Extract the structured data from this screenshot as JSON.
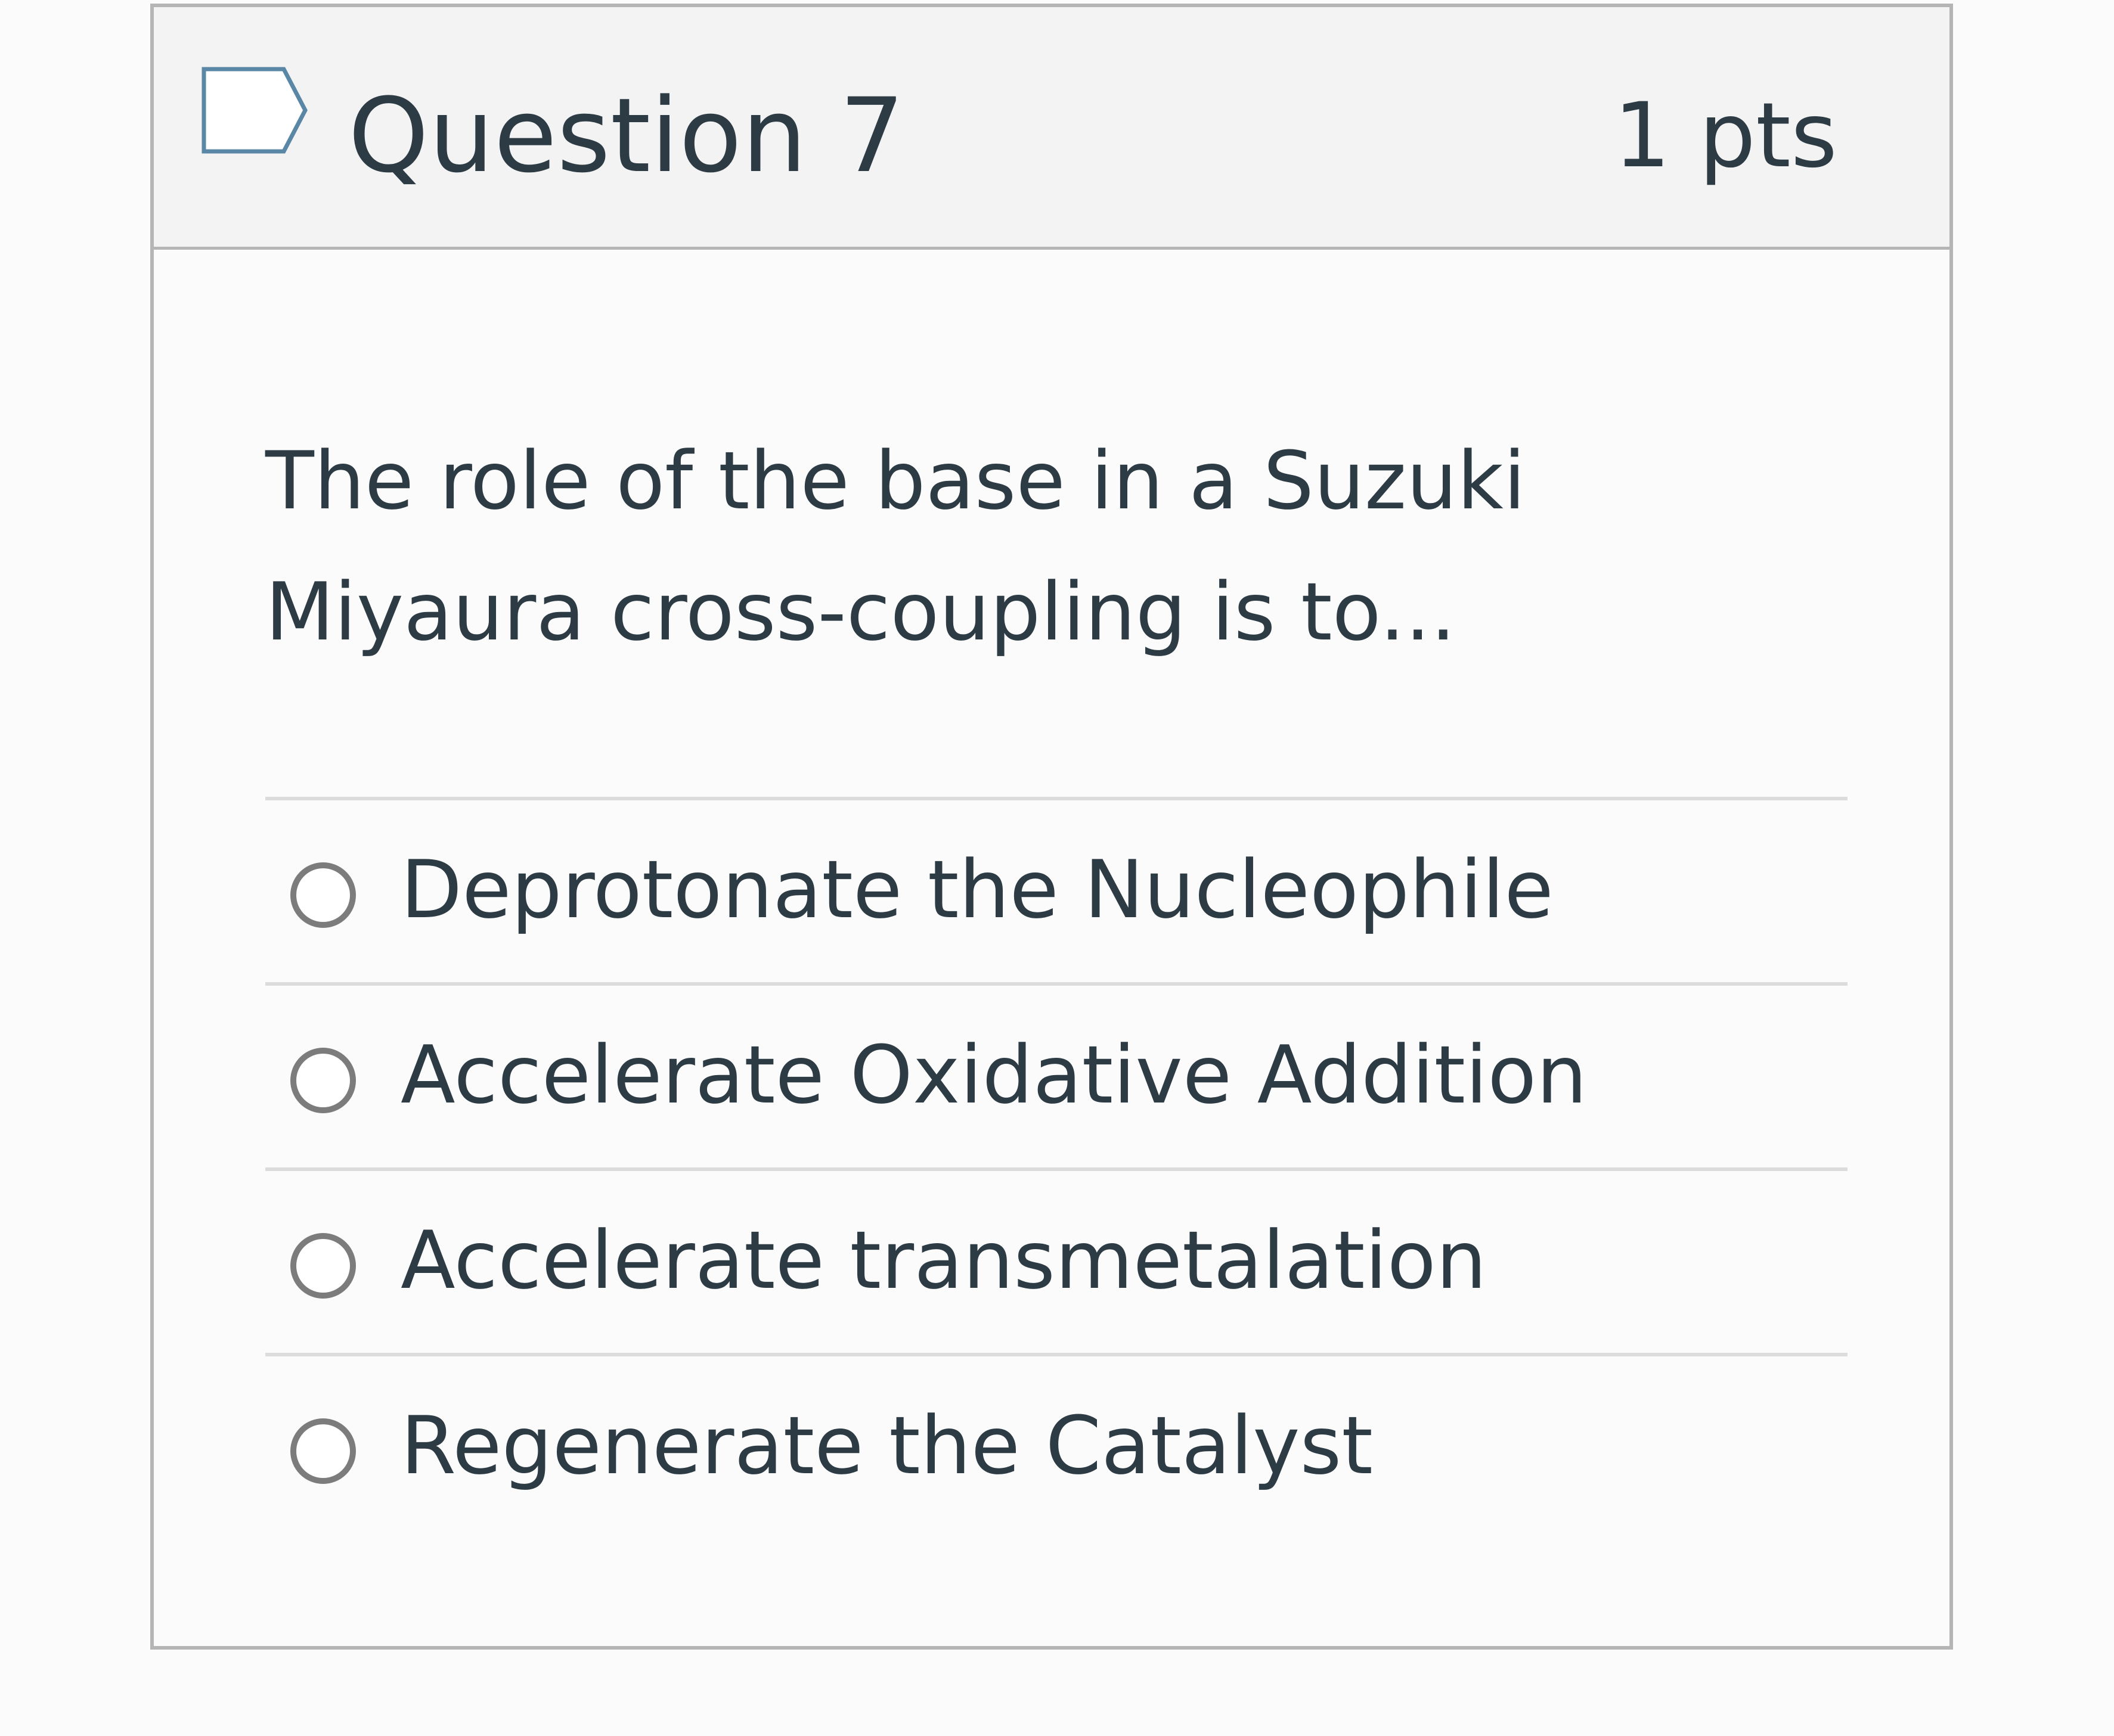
{
  "question": {
    "title": "Question 7",
    "points": "1 pts",
    "flag_icon": "flag-outline-icon",
    "text": "The role of the base in a Suzuki Miyaura cross-coupling is to..."
  },
  "answers": [
    {
      "label": "Deprotonate the Nucleophile",
      "selected": false
    },
    {
      "label": "Accelerate Oxidative Addition",
      "selected": false
    },
    {
      "label": "Accelerate transmetalation",
      "selected": false
    },
    {
      "label": "Regenerate the Catalyst",
      "selected": false
    }
  ],
  "colors": {
    "text": "#2d3b45",
    "header_bg": "#f3f3f3",
    "border": "#b5b5b5",
    "flag": "#5a87a6"
  }
}
